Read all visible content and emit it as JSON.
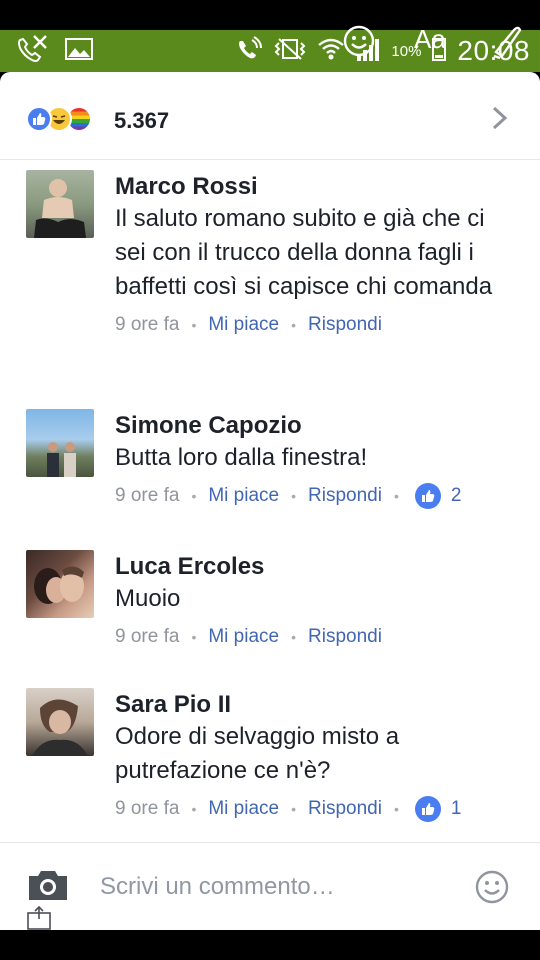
{
  "status_bar": {
    "battery": "10%",
    "time": "20:08",
    "overlay_text": "Aa"
  },
  "reactions": {
    "types": [
      "like",
      "haha",
      "pride"
    ],
    "count": "5.367"
  },
  "comments": [
    {
      "author": "Marco Rossi",
      "text": "Il saluto romano subito e già che ci sei con il trucco della donna fagli i baffetti così si capisce chi comanda",
      "time": "9 ore fa",
      "like_label": "Mi piace",
      "reply_label": "Rispondi",
      "likes": ""
    },
    {
      "author": "Simone Capozio",
      "text": "Butta loro dalla finestra!",
      "time": "9 ore fa",
      "like_label": "Mi piace",
      "reply_label": "Rispondi",
      "likes": "2"
    },
    {
      "author": "Luca Ercoles",
      "text": "Muoio",
      "time": "9 ore fa",
      "like_label": "Mi piace",
      "reply_label": "Rispondi",
      "likes": ""
    },
    {
      "author": "Sara Pio II",
      "text": "Odore di selvaggio misto a putrefazione ce n'è?",
      "time": "9 ore fa",
      "like_label": "Mi piace",
      "reply_label": "Rispondi",
      "likes": "1"
    }
  ],
  "composer": {
    "placeholder": "Scrivi un commento…"
  },
  "separator": "•",
  "colors": {
    "status_bar": "#5a8a1c",
    "link": "#4267b2",
    "like_blue": "#4a7ef0",
    "meta_gray": "#90949c",
    "text": "#1d2129"
  }
}
